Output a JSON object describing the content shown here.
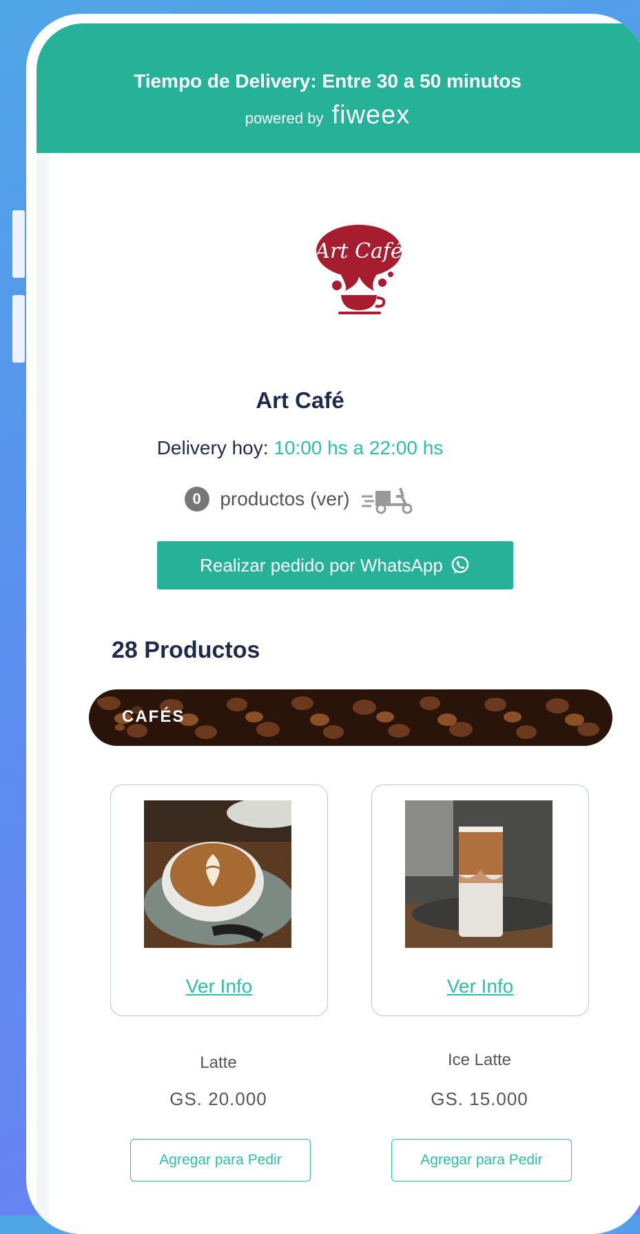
{
  "header": {
    "delivery_time": "Tiempo de Delivery: Entre 30 a 50 minutos",
    "powered_by": "powered by",
    "brand": "fiweex",
    "color": "#26b199"
  },
  "store": {
    "logo_text": "Art Café",
    "name": "Art Café",
    "hours_label": "Delivery hoy:",
    "hours_value": "10:00 hs a 22:00 hs"
  },
  "cart": {
    "count": "0",
    "label": "productos (ver)"
  },
  "whatsapp_button": {
    "label": "Realizar pedido por WhatsApp",
    "icon": "whatsapp-icon"
  },
  "products_count": "28 Productos",
  "category": {
    "title": "CAFÉS"
  },
  "products": [
    {
      "name": "Latte",
      "price": "GS. 20.000",
      "info_link": "Ver Info",
      "add_button": "Agregar para Pedir"
    },
    {
      "name": "Ice Latte",
      "price": "GS. 15.000",
      "info_link": "Ver Info",
      "add_button": "Agregar para Pedir"
    }
  ],
  "colors": {
    "accent": "#26b199",
    "link": "#2bc0a4",
    "title": "#1e2a4a"
  }
}
